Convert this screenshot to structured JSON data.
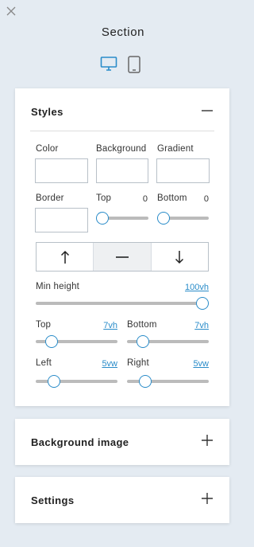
{
  "panel": {
    "title": "Section",
    "close_icon": "close-icon",
    "devices": [
      {
        "name": "desktop-icon",
        "active": true
      },
      {
        "name": "mobile-icon",
        "active": false
      }
    ]
  },
  "styles": {
    "heading": "Styles",
    "toggle_icon": "minus-icon",
    "color_label": "Color",
    "background_label": "Background",
    "gradient_label": "Gradient",
    "border_label": "Border",
    "border_top_label": "Top",
    "border_top_value": "0",
    "border_bottom_label": "Bottom",
    "border_bottom_value": "0",
    "align_buttons": [
      {
        "name": "align-top-icon",
        "active": false
      },
      {
        "name": "align-center-icon",
        "active": true
      },
      {
        "name": "align-bottom-icon",
        "active": false
      }
    ],
    "min_height_label": "Min height",
    "min_height_value": "100vh",
    "padding_top_label": "Top",
    "padding_top_value": "7vh",
    "padding_bottom_label": "Bottom",
    "padding_bottom_value": "7vh",
    "padding_left_label": "Left",
    "padding_left_value": "5vw",
    "padding_right_label": "Right",
    "padding_right_value": "5vw",
    "accent_color": "#2a8cc9"
  },
  "background_image": {
    "heading": "Background image",
    "toggle_icon": "plus-icon"
  },
  "settings": {
    "heading": "Settings",
    "toggle_icon": "plus-icon"
  }
}
